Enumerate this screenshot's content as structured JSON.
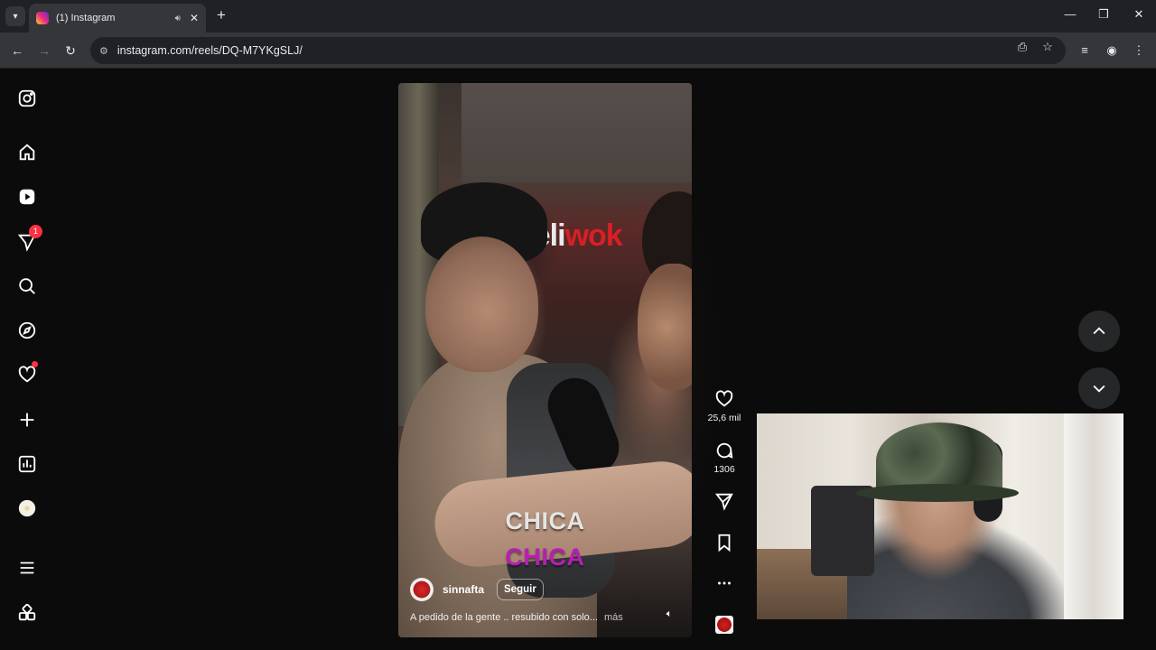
{
  "browser": {
    "tab_title": "(1) Instagram",
    "url": "instagram.com/reels/DQ-M7YKgSLJ/"
  },
  "sidebar": {
    "notifications_badge": "1"
  },
  "reel": {
    "caption_line1": "CHICA",
    "caption_line2": "CHICA",
    "sign_text_white": "deli",
    "sign_text_red": "wok",
    "username": "sinnafta",
    "follow_label": "Seguir",
    "description": "A pedido de la gente .. resubido con solo... ",
    "more_label": "más"
  },
  "actions": {
    "likes": "25,6 mil",
    "comments": "1306"
  },
  "colors": {
    "badge": "#ff3040",
    "caption_purple": "#b61fb3",
    "background": "#0b0b0c"
  }
}
